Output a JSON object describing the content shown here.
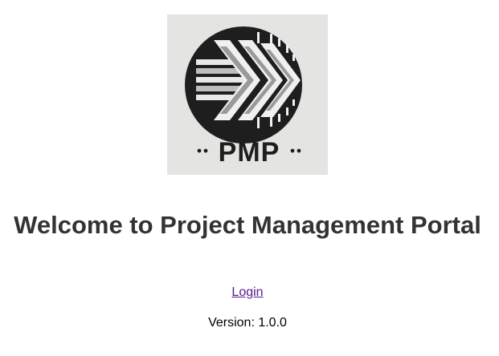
{
  "logo": {
    "icon": "pmp-chevron-arrow-logo",
    "wordmark": "PMP",
    "background_color": "#e4e4e2",
    "circle_color": "#1e1e1e"
  },
  "main": {
    "title": "Welcome to Project Management Portal",
    "login_label": "Login",
    "version_text": "Version: 1.0.0"
  },
  "colors": {
    "title": "#333333",
    "link_visited": "#551a8b"
  }
}
